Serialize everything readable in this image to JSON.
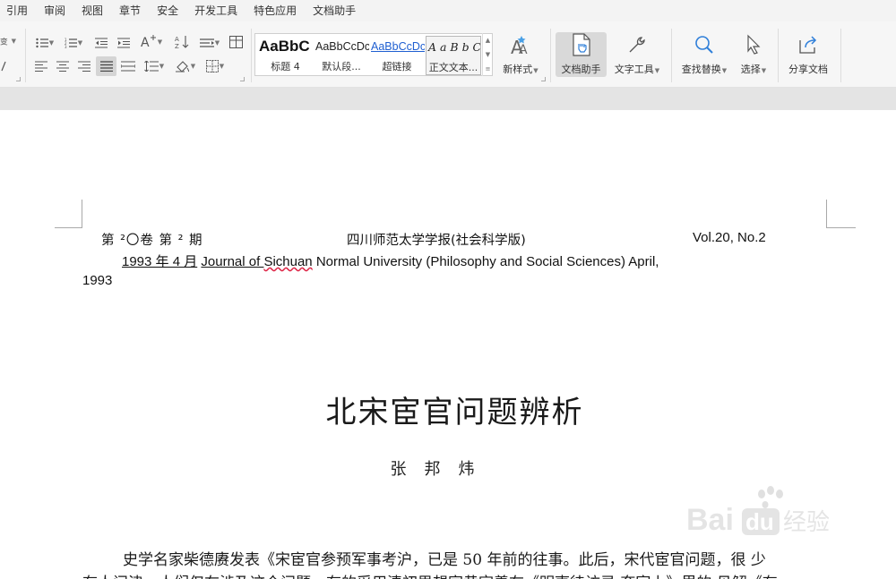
{
  "menu": [
    "引用",
    "审阅",
    "视图",
    "章节",
    "安全",
    "开发工具",
    "特色应用",
    "文档助手"
  ],
  "ribbon": {
    "styles": [
      {
        "sample": "AaBbC",
        "label": "标题 4"
      },
      {
        "sample": "AaBbCcDc",
        "label": "默认段..."
      },
      {
        "sample": "AaBbCcDc",
        "label": "超链接"
      },
      {
        "sample": "A a B b C",
        "label": "正文文本..."
      }
    ],
    "new_style": "新样式",
    "doc_assistant": "文档助手",
    "text_tools": "文字工具",
    "find_replace": "查找替换",
    "select": "选择",
    "share": "分享文档"
  },
  "document": {
    "header_left": "第 ²〇卷 第 ² 期",
    "header_center": "四川师范太学学报(社会科学版)",
    "header_right": "Vol.20, No.2",
    "line2_date": "1993 年 4 月",
    "line2_journal_a": "Journal of ",
    "line2_journal_b": "Sichuan",
    "line2_journal_c": " Normal University (Philosophy and Social Sciences) April,",
    "line3": "1993",
    "title": "北宋宦官问题辨析",
    "author": "张邦炜",
    "body_line1": "史学名家柴德赓发表《宋宦官参预军事考沪，已是 50 年前的往事。此后，宋代宦官问题，很 少",
    "body_line2": "有人问津，人们仅在涉及这个问题。有的采用清初思想家黄宗羲在《明夷待访录·奄宦上》里的 见解《有"
  },
  "watermark": {
    "brand": "Bai",
    "brand2": "du",
    "suffix": "经验"
  }
}
